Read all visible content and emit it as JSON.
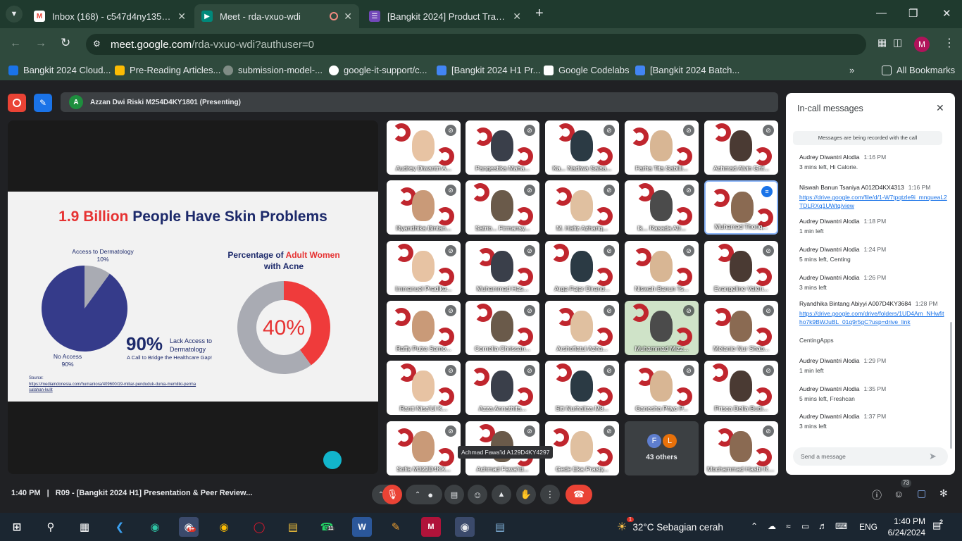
{
  "browser": {
    "tabs": [
      {
        "title": "Inbox (168) - c547d4ny1355@b",
        "favicon": "gmail-icon"
      },
      {
        "title": "Meet - rda-vxuo-wdi",
        "favicon": "meet-icon"
      },
      {
        "title": "[Bangkit 2024] Product Track Ca",
        "favicon": "forms-icon"
      }
    ],
    "url_host": "meet.google.com",
    "url_path": "/rda-vxuo-wdi?authuser=0",
    "profile_initial": "M",
    "bookmarks": [
      "Bangkit 2024 Cloud...",
      "Pre-Reading Articles...",
      "submission-model-...",
      "google-it-support/c...",
      "[Bangkit 2024 H1 Pr...",
      "Google Codelabs",
      "[Bangkit 2024 Batch..."
    ],
    "all_bookmarks": "All Bookmarks"
  },
  "meet": {
    "presenter_initial": "A",
    "presenting_label": "Azzan Dwi Riski M254D4KY1801 (Presenting)",
    "meeting_time": "1:40 PM",
    "separator": "|",
    "meeting_title": "R09 - [Bangkit 2024 H1] Presentation & Peer Review...",
    "participant_count": "73",
    "others_label": "43 others",
    "others_initials": [
      "F",
      "L"
    ],
    "hover_tooltip": "Achmad Fawa'id A129D4KY4297"
  },
  "slide": {
    "title_highlight": "1.9 Billion",
    "title_rest": " People Have Skin Problems",
    "pie_top_label": "Access to Dermatology",
    "pie_top_value": "10%",
    "pie_bottom_label": "No Access",
    "pie_bottom_value": "90%",
    "big_stat": "90%",
    "stat_desc_1": "Lack Access to",
    "stat_desc_2": "Dermatology",
    "stat_sub": "A Call to Bridge the Healthcare Gap!",
    "donut_title_1": "Percentage of ",
    "donut_title_hl": "Adult Women",
    "donut_title_2": "with Acne",
    "donut_value": "40%",
    "source_label": "Source:",
    "source_link": "https://mediaindonesia.com/humaniora/409600/19-miliar-penduduk-dunia-memiliki-permasalahan-kulit"
  },
  "chart_data": [
    {
      "type": "pie",
      "categories": [
        "Access to Dermatology",
        "No Access"
      ],
      "values": [
        10,
        90
      ],
      "colors": [
        "#a9abb3",
        "#353b8a"
      ]
    },
    {
      "type": "pie",
      "title": "Percentage of Adult Women with Acne",
      "categories": [
        "Adult Women with Acne",
        ""
      ],
      "values": [
        40,
        60
      ],
      "colors": [
        "#ef3b3b",
        "#a9abb3"
      ]
    }
  ],
  "participants": [
    "Audrey Diwantri A...",
    "Pangestika Maha...",
    "Ka... Nadiwa Salsa...",
    "Farha Tita Sabilli...",
    "Achmad Alvin Grif...",
    "Ryandhika Bintan...",
    "Satrio... Firmansy...",
    "M. Hafiz Azhariq...",
    "Ik... Rasada A0...",
    "Muhamad Thoriq...",
    "Immanuel Pradika...",
    "Muhammad Has...",
    "Arga Fajar Dirand...",
    "Niswah Banun Ts...",
    "Evangeline Valeri...",
    "Raffy Putra Samo...",
    "Cornelia Chrissan...",
    "Arshoflatul Azha...",
    "Muhammad Mizz...",
    "Melanie Nur Shab...",
    "Ranti Nisa'Ul K...",
    "Azza Annathifa...",
    "Siti Nurhaliza M3...",
    "Ganesha Priyo P...",
    "Prisca Della Budi...",
    "Sofia M322D4KX...",
    "Achmad Fawa'id...",
    "Gede Eka Prasty...",
    "",
    "Mochammad Hasbi Rizqull..."
  ],
  "chat": {
    "title": "In-call messages",
    "notice": "Messages are being recorded with the call",
    "messages": [
      {
        "who": "Audrey Diwantri Alodia",
        "time": "1:16 PM",
        "text": "3 mins left, Hi Calorie."
      },
      {
        "who": "Niswah Banun Tsaniya A012D4KX4313",
        "time": "1:16 PM",
        "link": "https://drive.google.com/file/d/1-W7tpqtzle9i_mnqueaL2TDLRXq1UWtq/view"
      },
      {
        "who": "Audrey Diwantri Alodia",
        "time": "1:18 PM",
        "text": "1 min left"
      },
      {
        "who": "Audrey Diwantri Alodia",
        "time": "1:24 PM",
        "text": "5 mins left, Centing"
      },
      {
        "who": "Audrey Diwantri Alodia",
        "time": "1:26 PM",
        "text": "3 mins left"
      },
      {
        "who": "Ryandhika Bintang Abiyyi A007D4KY3684",
        "time": "1:28 PM",
        "link": "https://drive.google.com/drive/folders/1UD4Am_NHwfitho7k9BWJuBL_01q9r5gC?usp=drive_link",
        "extra": "CentingApps"
      },
      {
        "who": "Audrey Diwantri Alodia",
        "time": "1:29 PM",
        "text": "1 min left"
      },
      {
        "who": "Audrey Diwantri Alodia",
        "time": "1:35 PM",
        "text": "5 mins left, Freshcan"
      },
      {
        "who": "Audrey Diwantri Alodia",
        "time": "1:37 PM",
        "text": "3 mins left"
      }
    ],
    "input_placeholder": "Send a message"
  },
  "taskbar": {
    "weather": "32°C  Sebagian cerah",
    "weather_badge": "1",
    "lang": "ENG",
    "time": "1:40 PM",
    "date": "6/24/2024",
    "notif_count": "2",
    "chrome_badge": "9+",
    "whatsapp_badge": "11"
  }
}
